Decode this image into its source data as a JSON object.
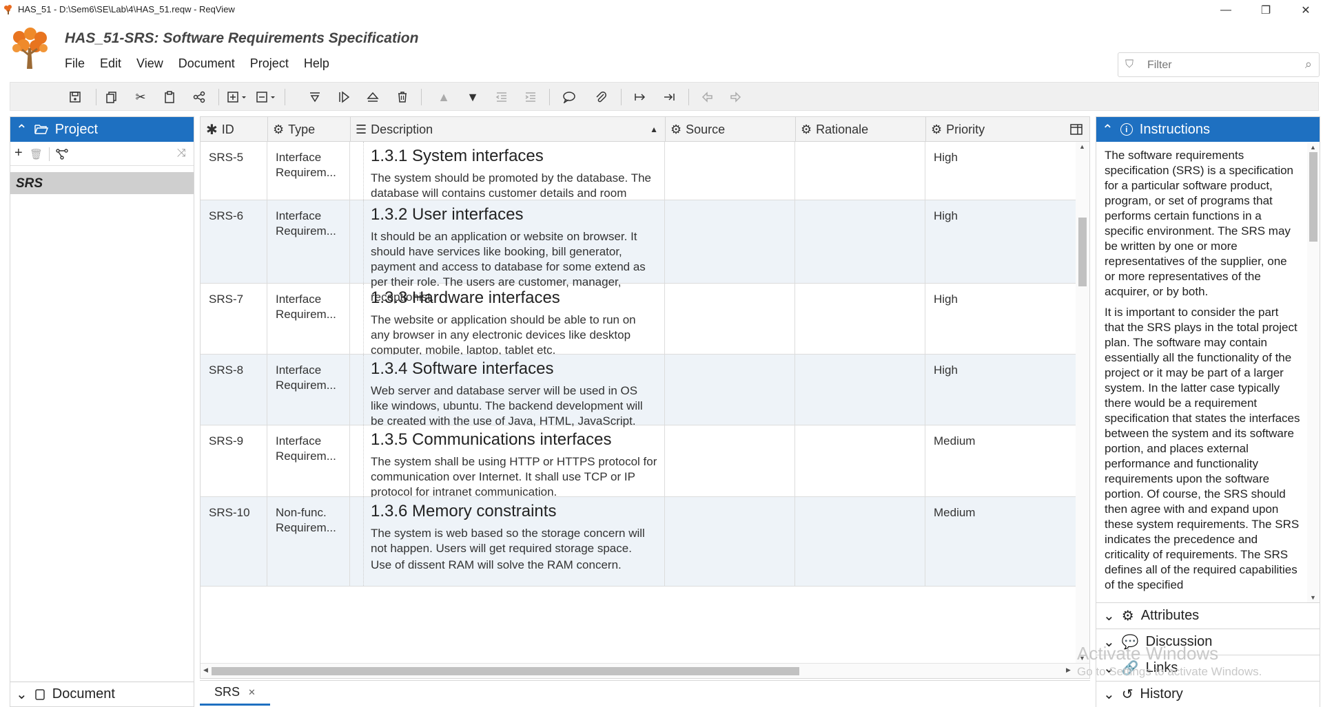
{
  "window": {
    "title": "HAS_51 - D:\\Sem6\\SE\\Lab\\4\\HAS_51.reqw - ReqView",
    "minimize_glyph": "—",
    "maximize_glyph": "❐",
    "close_glyph": "✕"
  },
  "header": {
    "doc_title": "HAS_51-SRS: Software Requirements Specification",
    "menu": [
      "File",
      "Edit",
      "View",
      "Document",
      "Project",
      "Help"
    ],
    "filter_placeholder": "Filter"
  },
  "toolbar": {
    "icons": [
      "save-icon",
      "copy-icon",
      "cut-icon",
      "paste-icon",
      "share-icon",
      "insert-icon",
      "delete-section-icon",
      "filter-down-icon",
      "play-step-icon",
      "eject-icon",
      "trash-icon",
      "move-up-icon",
      "move-down-icon",
      "outdent-icon",
      "indent-icon",
      "comment-icon",
      "attach-icon",
      "link-right-icon",
      "link-end-icon",
      "back-icon",
      "forward-icon"
    ]
  },
  "left_pane": {
    "header": "Project",
    "tree_item": "SRS",
    "bottom_section": "Document"
  },
  "grid": {
    "columns": [
      "ID",
      "Type",
      "Description",
      "Source",
      "Rationale",
      "Priority"
    ],
    "rows": [
      {
        "id": "SRS-5",
        "type1": "Interface",
        "type2": "Requirem...",
        "heading": "1.3.1 System interfaces",
        "text": "The system should be promoted by the database. The database will contains customer details and room details.",
        "text2": "",
        "priority": "High"
      },
      {
        "id": "SRS-6",
        "type1": "Interface",
        "type2": "Requirem...",
        "heading": "1.3.2 User interfaces",
        "text": "It should be an application or website on browser. It should have services like booking, bill generator, payment and access to database for some extend as per their role. The users are customer, manager, receptionist.",
        "text2": "",
        "priority": "High"
      },
      {
        "id": "SRS-7",
        "type1": "Interface",
        "type2": "Requirem...",
        "heading": "1.3.3 Hardware interfaces",
        "text": "The website or application should be able to run on any browser in any electronic devices like desktop computer, mobile, laptop, tablet etc.",
        "text2": "",
        "priority": "High"
      },
      {
        "id": "SRS-8",
        "type1": "Interface",
        "type2": "Requirem...",
        "heading": "1.3.4 Software interfaces",
        "text": "Web server and database server will be used in OS like windows, ubuntu. The backend development will be created with the use of Java, HTML, JavaScript.",
        "text2": "",
        "priority": "High"
      },
      {
        "id": "SRS-9",
        "type1": "Interface",
        "type2": "Requirem...",
        "heading": "1.3.5 Communications interfaces",
        "text": "The system shall be using HTTP or HTTPS protocol  for communication over Internet. It shall use TCP or IP protocol for intranet communication.",
        "text2": "",
        "priority": "Medium"
      },
      {
        "id": "SRS-10",
        "type1": "Non-func.",
        "type2": "Requirem...",
        "heading": "1.3.6 Memory constraints",
        "text": "The system is web based so the storage concern will not happen. Users will get required storage space.",
        "text2": "Use of dissent RAM will solve the RAM concern.",
        "priority": "Medium"
      }
    ]
  },
  "tabs": {
    "doc_tab": "SRS",
    "close_glyph": "✕"
  },
  "right_pane": {
    "header": "Instructions",
    "para1": "The software requirements specification (SRS) is a specification for a particular software product, program, or set of programs that performs certain functions in a specific environment. The SRS may be written by one or more representatives of the supplier, one or more representatives of the acquirer, or by both.",
    "para2": "It is important to consider the part that the SRS plays in the total project plan. The software may contain essentially all the functionality of the project or it may be part of a larger system. In the latter case typically there would be a requirement specification that states the interfaces between the system and its software portion, and places external performance and functionality requirements upon the software portion. Of course, the SRS should then agree with and expand upon these system requirements. The SRS indicates the precedence and criticality of requirements. The SRS defines all of the required capabilities of the specified",
    "sections": [
      "Attributes",
      "Discussion",
      "Links",
      "History"
    ]
  },
  "watermark": {
    "line1": "Activate Windows",
    "line2": "Go to Settings to activate Windows."
  }
}
